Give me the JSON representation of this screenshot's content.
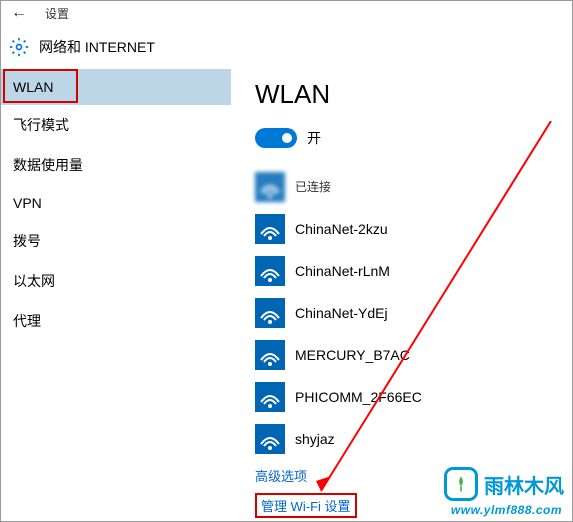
{
  "header": {
    "title": "设置"
  },
  "subheader": {
    "title": "网络和 INTERNET"
  },
  "sidebar": {
    "items": [
      {
        "label": "WLAN",
        "active": true
      },
      {
        "label": "飞行模式"
      },
      {
        "label": "数据使用量"
      },
      {
        "label": "VPN"
      },
      {
        "label": "拨号"
      },
      {
        "label": "以太网"
      },
      {
        "label": "代理"
      }
    ]
  },
  "main": {
    "title": "WLAN",
    "toggle_label": "开",
    "networks": [
      {
        "name": "",
        "status": "已连接",
        "blurred": true
      },
      {
        "name": "ChinaNet-2kzu"
      },
      {
        "name": "ChinaNet-rLnM"
      },
      {
        "name": "ChinaNet-YdEj"
      },
      {
        "name": "MERCURY_B7AC"
      },
      {
        "name": "PHICOMM_2F66EC"
      },
      {
        "name": "shyjaz"
      }
    ],
    "links": {
      "advanced": "高级选项",
      "manage": "管理 Wi-Fi 设置"
    }
  },
  "watermark": {
    "text": "雨林木风",
    "url": "www.ylmf888.com"
  }
}
